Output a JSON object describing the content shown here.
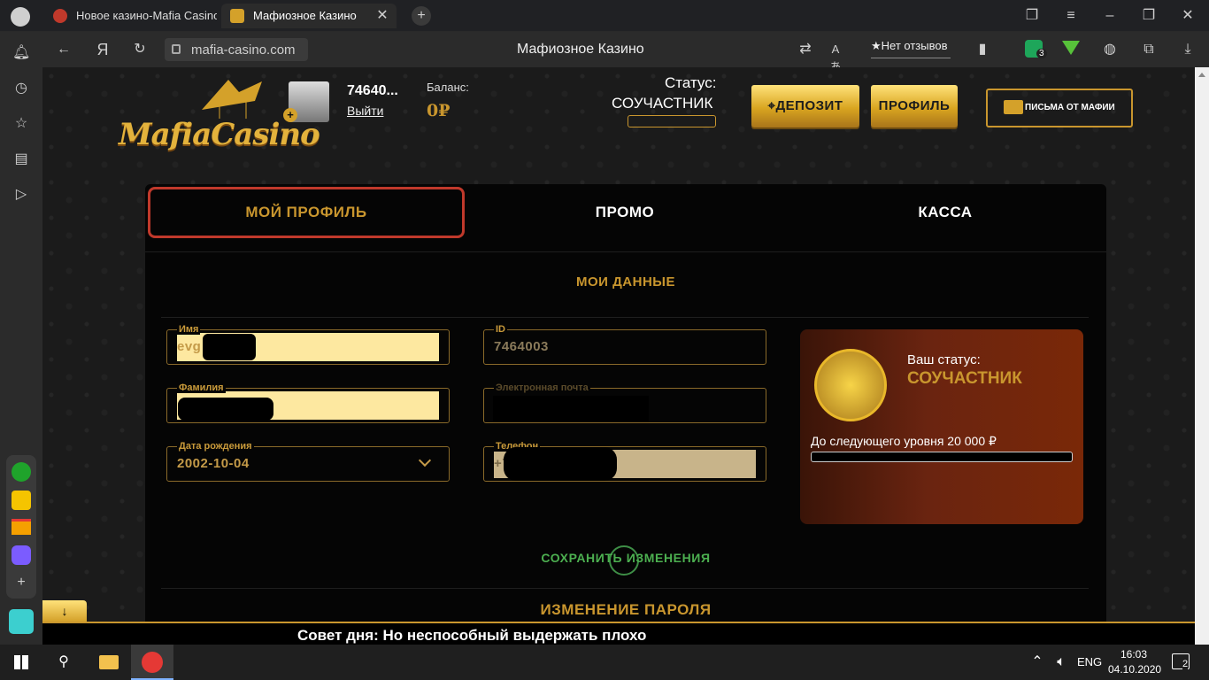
{
  "browser": {
    "tabs": [
      {
        "title": "Новое казино-Mafia Casino"
      },
      {
        "title": "Мафиозное Казино"
      }
    ],
    "address": "mafia-casino.com",
    "page_title": "Мафиозное Казино",
    "reviews_label": "Нет отзывов",
    "yandex_letter": "Я",
    "shield_badge": "3"
  },
  "header": {
    "logo_text": "MafiaCasino",
    "user_id_short": "74640...",
    "logout_label": "Выйти",
    "balance_label": "Баланс:",
    "balance_value": "0₽",
    "status_label": "Статус:",
    "status_value": "СОУЧАСТНИК",
    "deposit_label": "ДЕПОЗИТ",
    "profile_label": "ПРОФИЛЬ",
    "letters_label": "ПИСЬМА ОТ МАФИИ"
  },
  "tabs": [
    "МОЙ ПРОФИЛЬ",
    "ПРОМО",
    "КАССА"
  ],
  "profile": {
    "section_title": "МОИ ДАННЫЕ",
    "name_label": "Имя",
    "name_value": "evg",
    "surname_label": "Фамилия",
    "birth_label": "Дата рождения",
    "birth_value": "2002-10-04",
    "id_label": "ID",
    "id_value": "7464003",
    "email_label": "Электронная почта",
    "phone_label": "Телефон",
    "phone_value": "+7",
    "save_label": "СОХРАНИТЬ ИЗМЕНЕНИЯ",
    "password_title": "ИЗМЕНЕНИЕ ПАРОЛЯ"
  },
  "status_card": {
    "label": "Ваш статус:",
    "value": "СОУЧАСТНИК",
    "next_level": "До следующего уровня 20 000 ₽",
    "progress": 0
  },
  "ticker": "Совет дня: Но неспособный выдержать плохо",
  "taskbar": {
    "lang": "ENG",
    "time": "16:03",
    "date": "04.10.2020",
    "notifications": "2"
  },
  "colors": {
    "gold": "#c9962e",
    "panel": "#050505",
    "accent_red": "#c0392b",
    "save_green": "#4caf50"
  }
}
